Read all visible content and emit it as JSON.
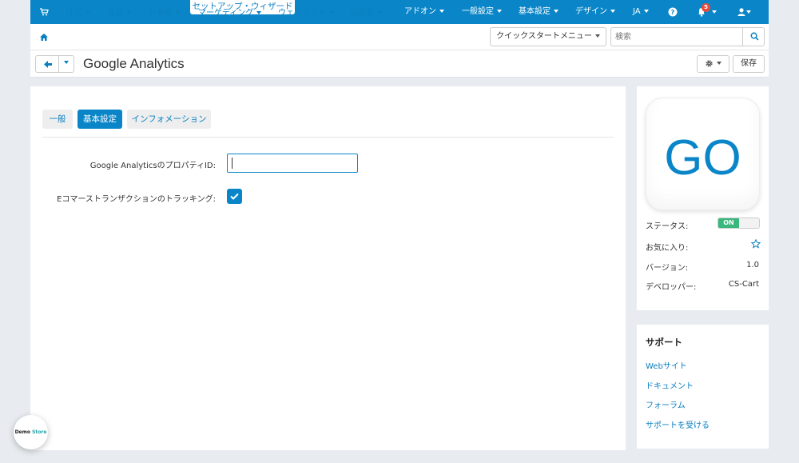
{
  "topbar": {
    "wizard": "セットアップ・ウィザード",
    "menu": {
      "addons": "アドオン",
      "general": "一般設定",
      "settings": "基本設定",
      "design": "デザイン",
      "lang": "JA"
    },
    "notifications_count": "5"
  },
  "nav": {
    "items": [
      "注文",
      "商品",
      "お客様",
      "マーケティング",
      "ウェブサイト",
      "出品者"
    ],
    "quickstart": "クイックスタートメニュー",
    "search_placeholder": "検索"
  },
  "titlebar": {
    "title": "Google Analytics",
    "save": "保存"
  },
  "tabs": {
    "general": "一般",
    "settings": "基本設定",
    "info": "インフォメーション"
  },
  "form": {
    "property_id_label": "Google AnalyticsのプロパティID:",
    "property_id_value": "",
    "ecommerce_label": "Eコマーストランザクションのトラッキング:",
    "ecommerce_checked": true
  },
  "addon": {
    "icon_text": "GO",
    "status_label": "ステータス:",
    "status_value": "ON",
    "favorite_label": "お気に入り:",
    "version_label": "バージョン:",
    "version_value": "1.0",
    "developer_label": "デベロッパー:",
    "developer_value": "CS-Cart"
  },
  "support": {
    "title": "サポート",
    "links": [
      "Webサイト",
      "ドキュメント",
      "フォーラム",
      "サポートを受ける"
    ]
  },
  "demo": {
    "part1": "Demo",
    "part2": "Store"
  },
  "colors": {
    "primary": "#0a86c8",
    "toggle_on": "#38b87c",
    "badge": "#e74c3c"
  }
}
